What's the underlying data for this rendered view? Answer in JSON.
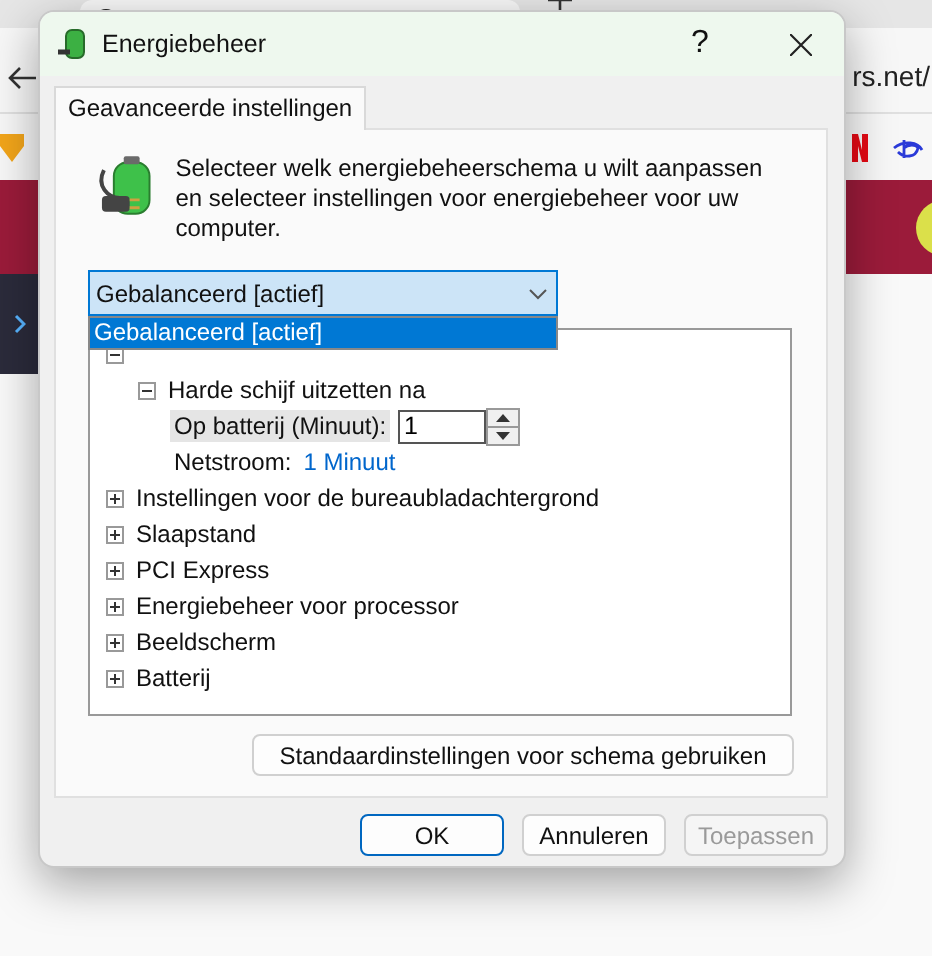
{
  "browser": {
    "address_fragment": "rs.net/"
  },
  "dialog": {
    "title": "Energiebeheer",
    "help": "?",
    "tabs": [
      {
        "label": "Geavanceerde instellingen",
        "selected": true
      }
    ],
    "description": "Selecteer welk energiebeheerschema u wilt aanpassen en selecteer instellingen voor energiebeheer voor uw computer.",
    "plan_select": {
      "value": "Gebalanceerd [actief]",
      "expanded": true,
      "options": [
        {
          "label": "Gebalanceerd [actief]",
          "selected": true
        }
      ]
    },
    "settings_tree": [
      {
        "expanded": true,
        "children": [
          {
            "label": "Harde schijf uitzetten na",
            "expanded": true,
            "children": [
              {
                "kind": "spin",
                "label": "Op batterij (Minuut):",
                "value": "1",
                "selected": true
              },
              {
                "kind": "value",
                "label": "Netstroom:",
                "value": "1 Minuut",
                "selected": false
              }
            ]
          }
        ]
      },
      {
        "label": "Instellingen voor de bureaubladachtergrond",
        "expanded": false
      },
      {
        "label": "Slaapstand",
        "expanded": false
      },
      {
        "label": "PCI Express",
        "expanded": false
      },
      {
        "label": "Energiebeheer voor processor",
        "expanded": false
      },
      {
        "label": "Beeldscherm",
        "expanded": false
      },
      {
        "label": "Batterij",
        "expanded": false
      }
    ],
    "restore_button": "Standaardinstellingen voor schema gebruiken",
    "buttons": [
      {
        "label": "OK",
        "default": true,
        "disabled": false
      },
      {
        "label": "Annuleren",
        "default": false,
        "disabled": false
      },
      {
        "label": "Toepassen",
        "default": false,
        "disabled": true
      }
    ]
  }
}
